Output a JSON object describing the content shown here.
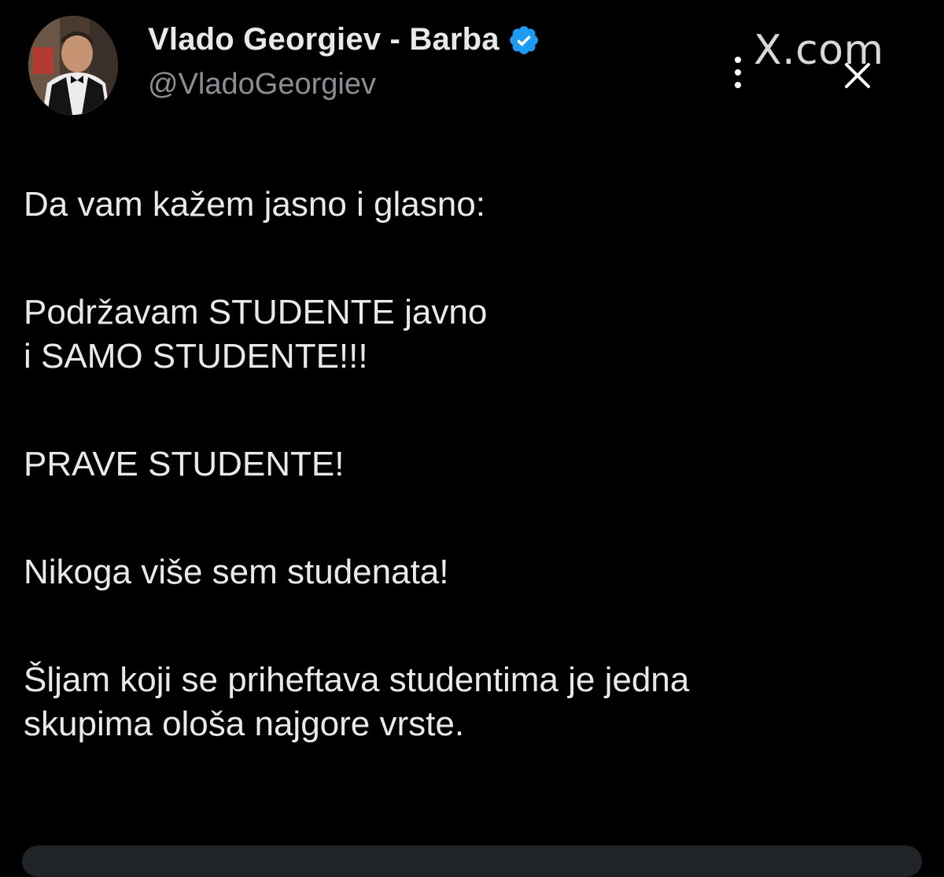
{
  "author": {
    "display_name": "Vlado Georgiev - Barba",
    "handle": "@VladoGeorgiev",
    "verified_icon": "verified-badge-icon",
    "verified_color": "#1d9bf0"
  },
  "header": {
    "source": "X.com",
    "more_icon": "vertical-ellipsis-icon",
    "close_icon": "close-icon"
  },
  "post": {
    "paragraphs": [
      "Da vam kažem jasno i glasno:",
      "Podržavam STUDENTE javno",
      "i SAMO STUDENTE!!!",
      "PRAVE STUDENTE!",
      "Nikoga više sem studenata!",
      "Šljam koji se priheftava studentima  je jedna",
      "skupima ološa najgore vrste."
    ]
  },
  "colors": {
    "background": "#000000",
    "text_primary": "#e7e9ea",
    "text_secondary": "#8b8f94"
  }
}
